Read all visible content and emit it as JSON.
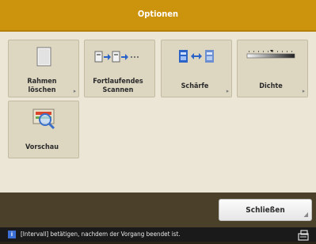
{
  "header": {
    "title": "Optionen"
  },
  "options": [
    {
      "label_line1": "Rahmen",
      "label_line2": "löschen",
      "icon": "page-icon",
      "has_more": true
    },
    {
      "label_line1": "Fortlaufendes",
      "label_line2": "Scannen",
      "icon": "continuous-scan-icon",
      "has_more": false
    },
    {
      "label_line1": "Schärfe",
      "label_line2": "",
      "icon": "sharpness-icon",
      "has_more": true
    },
    {
      "label_line1": "Dichte",
      "label_line2": "",
      "icon": "density-slider-icon",
      "has_more": true
    },
    {
      "label_line1": "Vorschau",
      "label_line2": "",
      "icon": "preview-magnifier-icon",
      "has_more": false
    }
  ],
  "more_indicator": "▸",
  "footer": {
    "close_label": "Schließen",
    "corner_glyph": "◢"
  },
  "status": {
    "info_glyph": "i",
    "message": "[Intervall] betätigen, nachdem der Vorgang beendet ist."
  },
  "colors": {
    "title_bar": "#cc930d",
    "panel": "#ebe6d5",
    "button": "#ddd7c2",
    "bottom_bar": "#4b412a",
    "status_bar": "#1a1a1a",
    "info_blue": "#3b6fd6"
  }
}
